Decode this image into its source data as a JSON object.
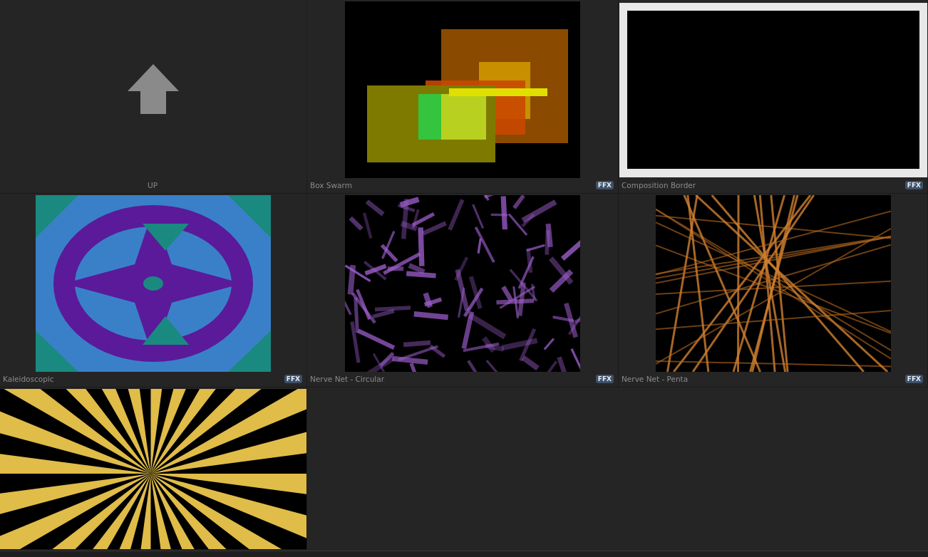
{
  "items": [
    {
      "kind": "up",
      "label": "UP"
    },
    {
      "kind": "effect",
      "label": "Box Swarm",
      "badge": "FFX"
    },
    {
      "kind": "effect",
      "label": "Composition Border",
      "badge": "FFX"
    },
    {
      "kind": "effect",
      "label": "Kaleidoscopic",
      "badge": "FFX"
    },
    {
      "kind": "effect",
      "label": "Nerve Net - Circular",
      "badge": "FFX"
    },
    {
      "kind": "effect",
      "label": "Nerve Net - Penta",
      "badge": "FFX"
    },
    {
      "kind": "effect"
    }
  ]
}
